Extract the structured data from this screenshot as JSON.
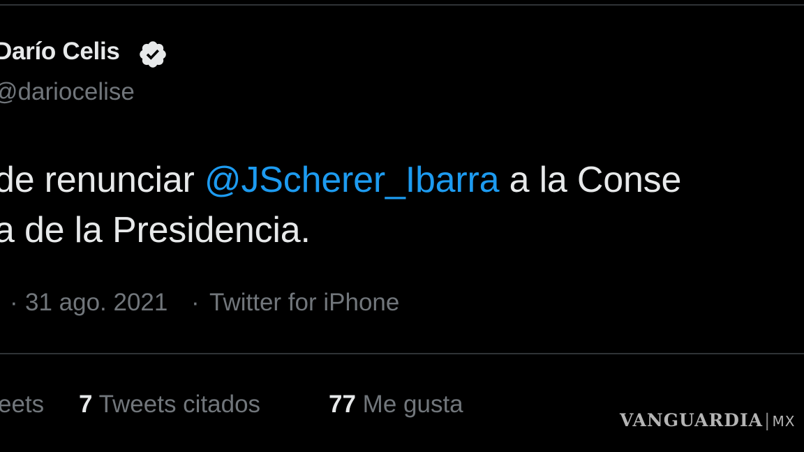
{
  "author": {
    "display_name": "Darío Celis",
    "handle": "@dariocelise",
    "verified_icon": "verified-badge-icon"
  },
  "tweet": {
    "line1_before": "de renunciar ",
    "mention": "@JScherer_Ibarra",
    "line1_after": " a la Conse",
    "line2": "a de la Presidencia."
  },
  "meta": {
    "separator_lead": "·",
    "date": "31 ago. 2021",
    "separator": "·",
    "source": "Twitter for iPhone"
  },
  "stats": {
    "retweets_partial": "eets",
    "quotes_count": "7",
    "quotes_label": "Tweets citados",
    "likes_count": "77",
    "likes_label": "Me gusta"
  },
  "watermark": {
    "brand": "VANGUARDIA",
    "separator": "|",
    "suffix": "MX"
  },
  "colors": {
    "background": "#000000",
    "text": "#e7e9ea",
    "muted": "#71767b",
    "link": "#1d9bf0",
    "divider": "#2f3336"
  }
}
